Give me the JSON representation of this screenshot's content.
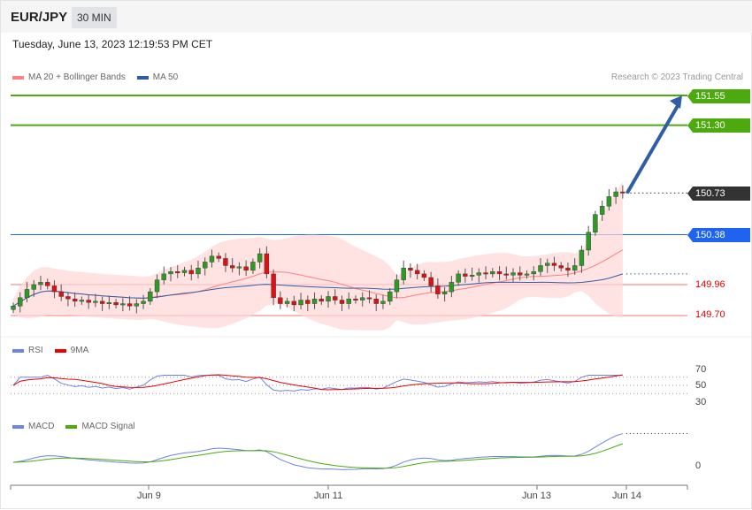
{
  "header": {
    "pair": "EUR/JPY",
    "timeframe": "30 MIN",
    "datetime": "Tuesday, June 13, 2023 12:19:53 PM CET"
  },
  "legend": {
    "ma20": "MA 20 + Bollinger Bands",
    "ma50": "MA 50",
    "rsi": "RSI",
    "rsi_ma": "9MA",
    "macd": "MACD",
    "macd_signal": "MACD Signal",
    "credit": "Research © 2023 Trading Central"
  },
  "colors": {
    "ma20": "#ff8080",
    "ma50": "#2f5ea6",
    "target": "#4caa0f",
    "current": "#333333",
    "pivot": "#1e64f0",
    "support": "#ee0000",
    "up": "#2e9a24",
    "down": "#dd1111",
    "rsi": "#6b84e0",
    "rsi_ma": "#ee0000",
    "macd": "#6b84e0",
    "signal": "#4caa0f"
  },
  "levels": {
    "r2": "151.55",
    "r1": "151.30",
    "current": "150.73",
    "pivot": "150.38",
    "s1": "149.96",
    "s2": "149.70"
  },
  "rsi_levels": [
    "70",
    "50",
    "30"
  ],
  "macd_zero": "0",
  "x_labels": [
    "Jun 9",
    "Jun 11",
    "Jun 13",
    "Jun 14"
  ],
  "chart_data": {
    "type": "candlestick",
    "price_range": [
      149.62,
      151.62
    ],
    "closes": [
      149.78,
      149.85,
      149.92,
      149.96,
      149.98,
      149.95,
      149.9,
      149.86,
      149.84,
      149.82,
      149.83,
      149.81,
      149.82,
      149.8,
      149.81,
      149.79,
      149.8,
      149.78,
      149.8,
      149.82,
      149.9,
      150.0,
      150.05,
      150.07,
      150.06,
      150.08,
      150.05,
      150.1,
      150.15,
      150.2,
      150.18,
      150.12,
      150.1,
      150.11,
      150.08,
      150.15,
      150.22,
      150.05,
      149.85,
      149.8,
      149.82,
      149.79,
      149.83,
      149.8,
      149.84,
      149.82,
      149.86,
      149.83,
      149.8,
      149.84,
      149.83,
      149.85,
      149.84,
      149.8,
      149.82,
      149.9,
      150.0,
      150.1,
      150.08,
      150.05,
      150.02,
      149.95,
      149.88,
      149.9,
      149.98,
      150.05,
      150.03,
      150.04,
      150.06,
      150.05,
      150.07,
      150.05,
      150.04,
      150.06,
      150.04,
      150.05,
      150.07,
      150.12,
      150.14,
      150.12,
      150.1,
      150.08,
      150.12,
      150.25,
      150.4,
      150.55,
      150.62,
      150.7,
      150.74,
      150.73
    ],
    "forecast_target": 151.55
  }
}
